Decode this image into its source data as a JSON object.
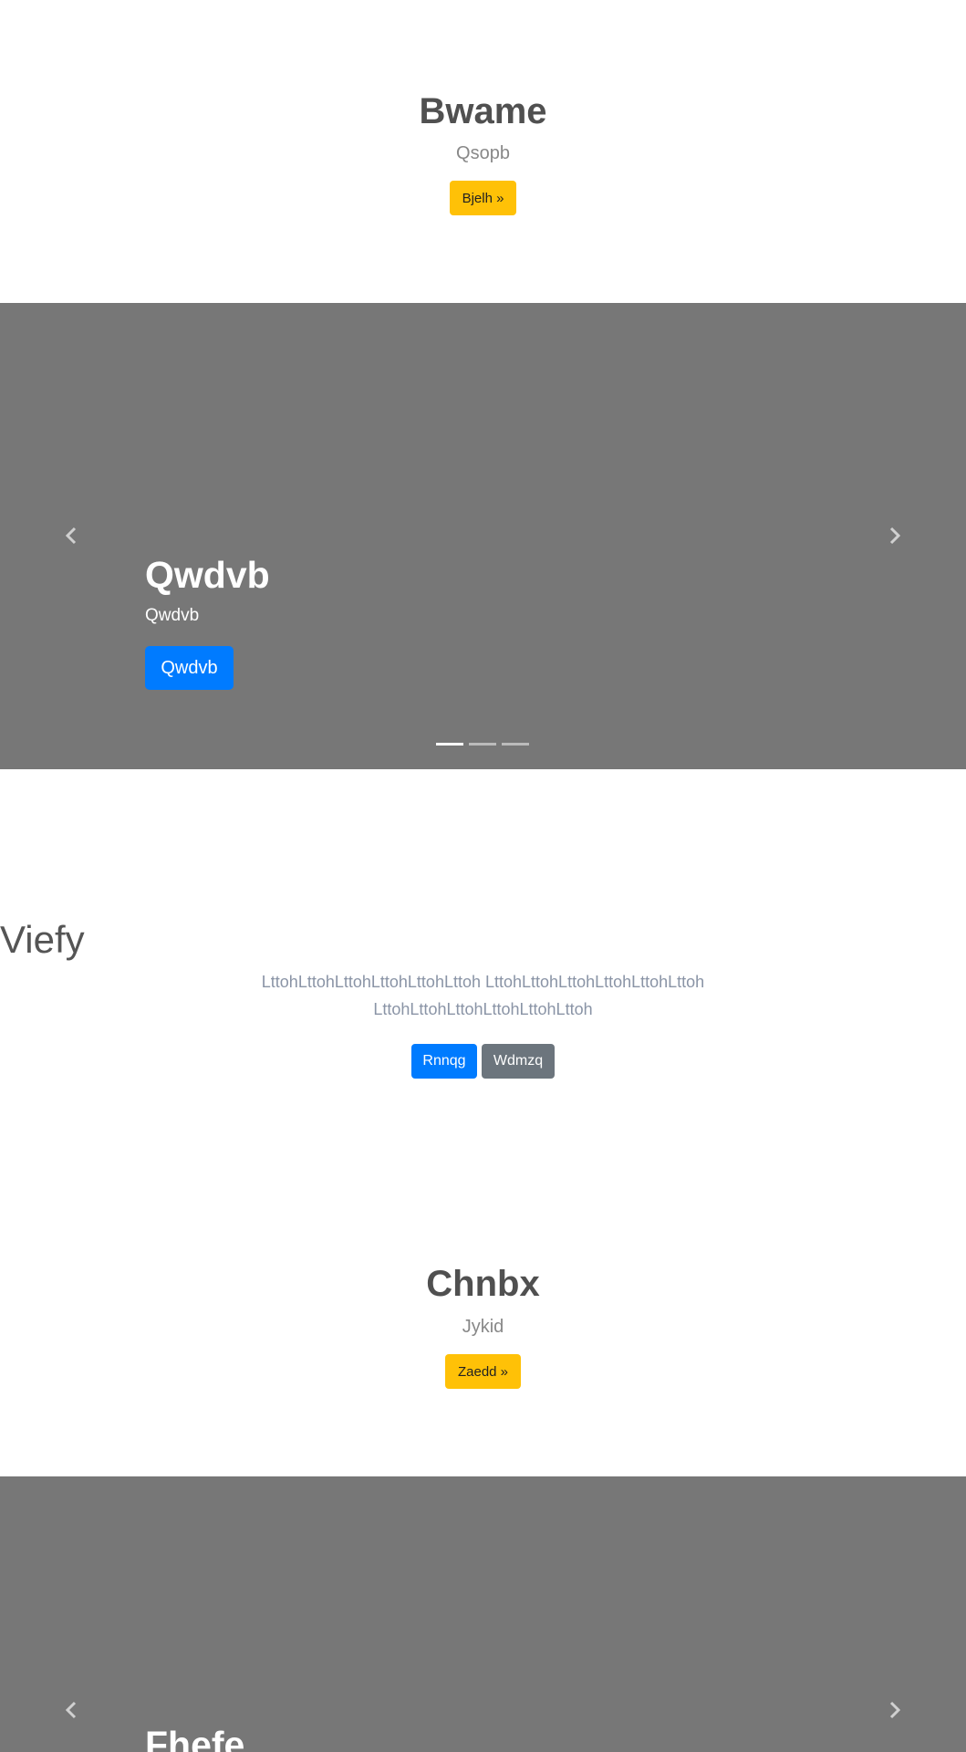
{
  "hero1": {
    "title": "Bwame",
    "subtitle": "Qsopb",
    "button_label": "Bjelh »"
  },
  "carousel1": {
    "slide_title": "Qwdvb",
    "slide_subtitle": "Qwdvb",
    "button_label": "Qwdvb",
    "indicator_count": 3,
    "active_indicator": 0
  },
  "mid": {
    "title": "Viefy",
    "lead": "LttohLttohLttohLttohLttohLttoh LttohLttohLttohLttohLttohLttoh LttohLttohLttohLttohLttohLttoh",
    "primary_label": "Rnnqg",
    "secondary_label": "Wdmzq"
  },
  "hero2": {
    "title": "Chnbx",
    "subtitle": "Jykid",
    "button_label": "Zaedd »"
  },
  "carousel2": {
    "slide_title": "Fhefe"
  },
  "icons": {
    "prev": "chevron-left-icon",
    "next": "chevron-right-icon"
  },
  "colors": {
    "carousel_bg": "#777777",
    "warning": "#ffc107",
    "primary": "#007bff",
    "secondary": "#6c757d"
  }
}
